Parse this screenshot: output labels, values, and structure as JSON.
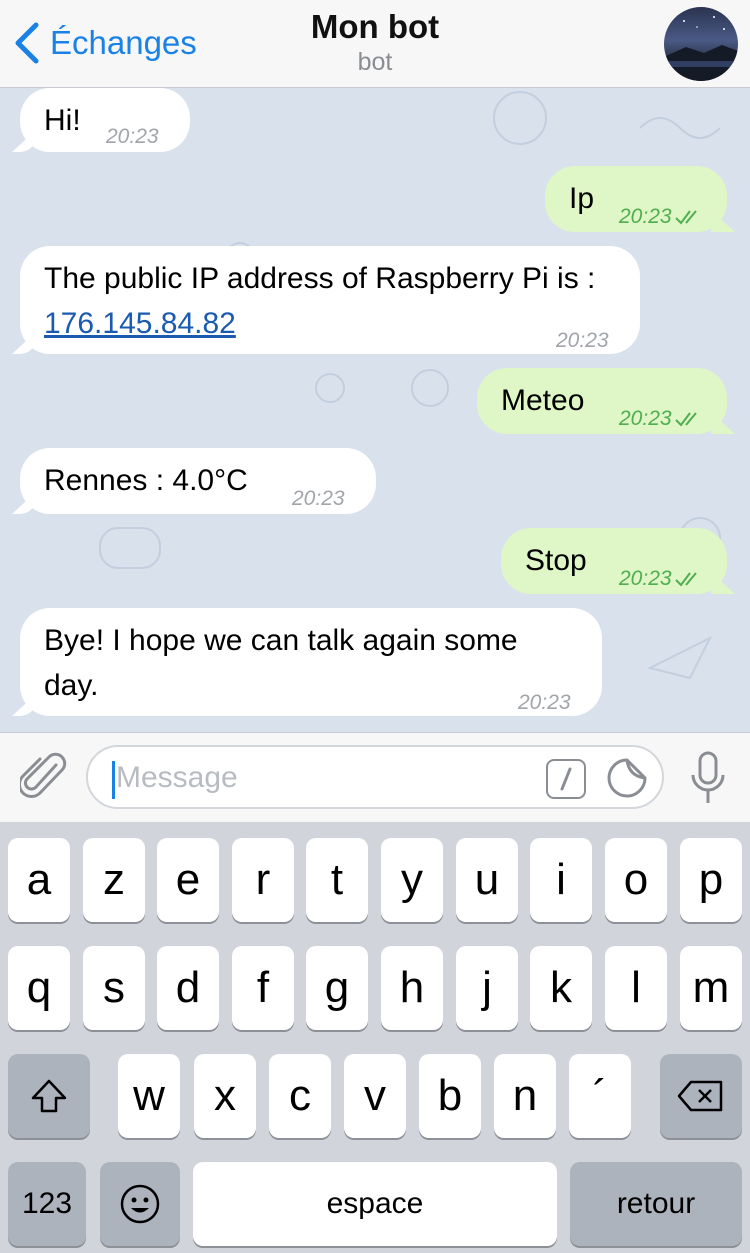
{
  "header": {
    "back_label": "Échanges",
    "title": "Mon bot",
    "subtitle": "bot"
  },
  "messages": [
    {
      "dir": "in",
      "text": "Hi!",
      "time": "20:23"
    },
    {
      "dir": "out",
      "text": "Ip",
      "time": "20:23"
    },
    {
      "dir": "in",
      "text_prefix": "The public IP address of Raspberry Pi is : ",
      "link": "176.145.84.82",
      "time": "20:23"
    },
    {
      "dir": "out",
      "text": "Meteo",
      "time": "20:23"
    },
    {
      "dir": "in",
      "text": "Rennes : 4.0°C",
      "time": "20:23"
    },
    {
      "dir": "out",
      "text": "Stop",
      "time": "20:23"
    },
    {
      "dir": "in",
      "text": "Bye! I hope we can talk again some day.",
      "time": "20:23"
    }
  ],
  "input": {
    "placeholder": "Message"
  },
  "keyboard": {
    "row1": [
      "a",
      "z",
      "e",
      "r",
      "t",
      "y",
      "u",
      "i",
      "o",
      "p"
    ],
    "row2": [
      "q",
      "s",
      "d",
      "f",
      "g",
      "h",
      "j",
      "k",
      "l",
      "m"
    ],
    "row3": [
      "w",
      "x",
      "c",
      "v",
      "b",
      "n",
      "´"
    ],
    "num_label": "123",
    "space_label": "espace",
    "return_label": "retour"
  },
  "colors": {
    "accent": "#1a82e6",
    "outgoing_bubble": "#dff6c6",
    "outgoing_time": "#4fae4e",
    "chat_bg": "#d8e1ec"
  }
}
